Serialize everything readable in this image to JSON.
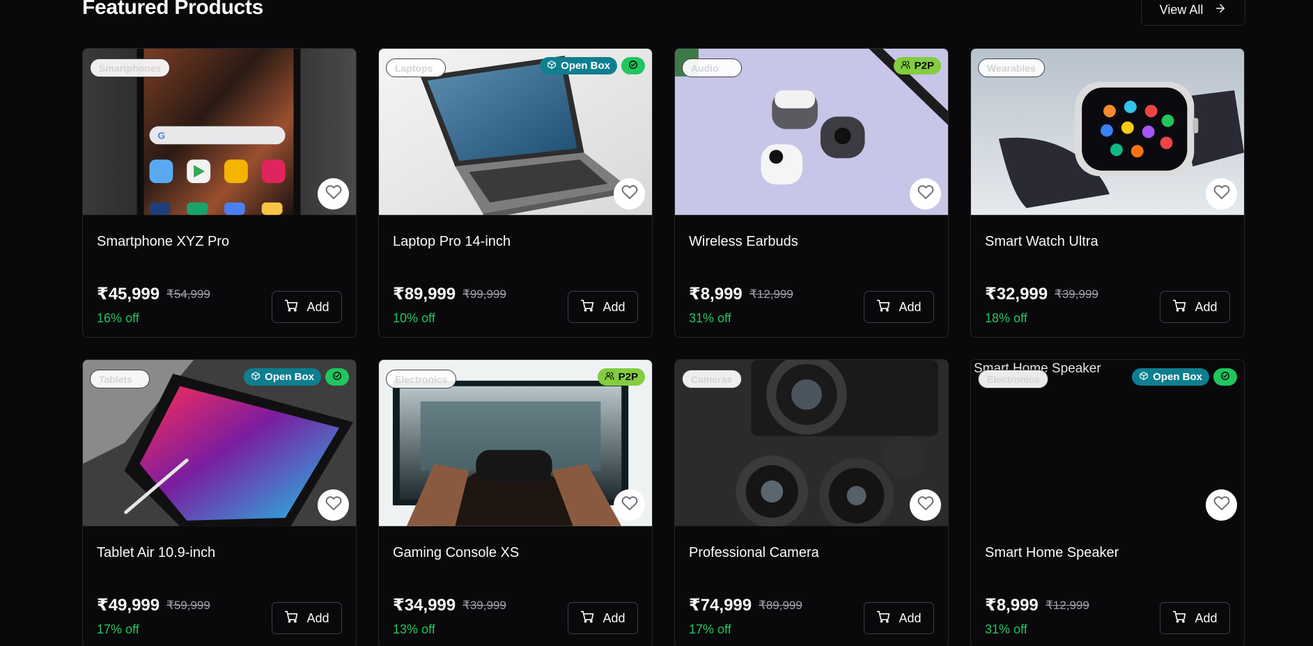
{
  "section": {
    "title": "Featured Products",
    "view_all_label": "View All"
  },
  "labels": {
    "add": "Add",
    "open_box": "Open Box",
    "p2p": "P2P"
  },
  "colors": {
    "discount": "#22c55e",
    "open_box": "#0e7f8f",
    "p2p": "#84cc40",
    "verified": "#22c55e"
  },
  "products": [
    {
      "name": "Smartphone XYZ Pro",
      "category": "Smartphones",
      "price": "₹45,999",
      "mrp": "₹54,999",
      "off": "16% off",
      "tags": [],
      "image": "phone"
    },
    {
      "name": "Laptop Pro 14-inch",
      "category": "Laptops",
      "price": "₹89,999",
      "mrp": "₹99,999",
      "off": "10% off",
      "tags": [
        "openbox",
        "verified"
      ],
      "image": "laptop"
    },
    {
      "name": "Wireless Earbuds",
      "category": "Audio",
      "price": "₹8,999",
      "mrp": "₹12,999",
      "off": "31% off",
      "tags": [
        "p2p"
      ],
      "image": "earbuds"
    },
    {
      "name": "Smart Watch Ultra",
      "category": "Wearables",
      "price": "₹32,999",
      "mrp": "₹39,999",
      "off": "18% off",
      "tags": [],
      "image": "watch"
    },
    {
      "name": "Tablet Air 10.9-inch",
      "category": "Tablets",
      "price": "₹49,999",
      "mrp": "₹59,999",
      "off": "17% off",
      "tags": [
        "openbox",
        "verified"
      ],
      "image": "tablet"
    },
    {
      "name": "Gaming Console XS",
      "category": "Electronics",
      "price": "₹34,999",
      "mrp": "₹39,999",
      "off": "13% off",
      "tags": [
        "p2p"
      ],
      "image": "console"
    },
    {
      "name": "Professional Camera",
      "category": "Cameras",
      "price": "₹74,999",
      "mrp": "₹89,999",
      "off": "17% off",
      "tags": [],
      "image": "camera"
    },
    {
      "name": "Smart Home Speaker",
      "category": "Electronics",
      "price": "₹8,999",
      "mrp": "₹12,999",
      "off": "31% off",
      "tags": [
        "openbox",
        "verified"
      ],
      "image": "broken",
      "image_alt": "Smart Home Speaker"
    }
  ]
}
